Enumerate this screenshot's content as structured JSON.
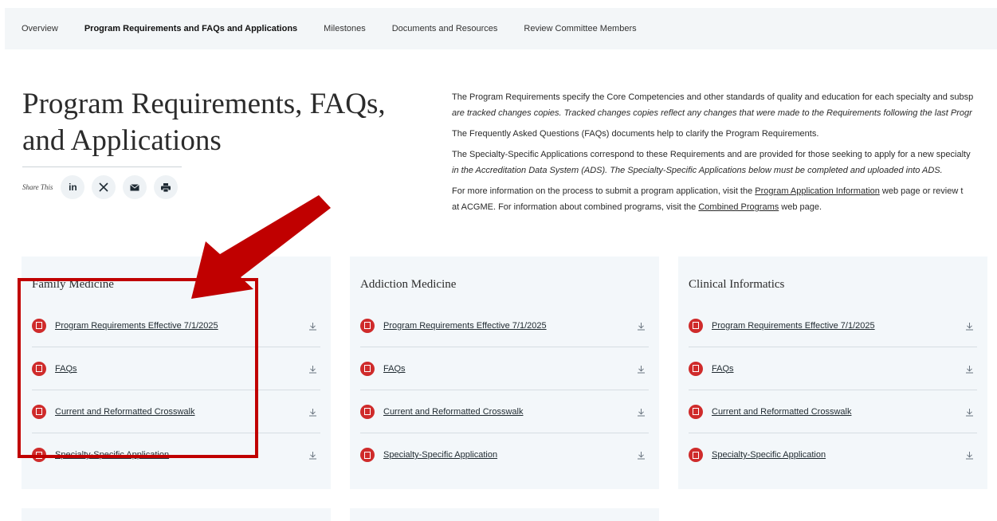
{
  "nav": {
    "items": [
      {
        "label": "Overview",
        "active": false
      },
      {
        "label": "Program Requirements and FAQs and Applications",
        "active": true
      },
      {
        "label": "Milestones",
        "active": false
      },
      {
        "label": "Documents and Resources",
        "active": false
      },
      {
        "label": "Review Committee Members",
        "active": false
      }
    ]
  },
  "page": {
    "title_line1": "Program Requirements, FAQs,",
    "title_line2": "and Applications"
  },
  "share": {
    "label": "Share This",
    "icons": [
      "linkedin-icon",
      "x-icon",
      "email-icon",
      "print-icon"
    ]
  },
  "intro": {
    "p1_line1": "The Program Requirements specify the Core Competencies and other standards of quality and education for each specialty and subsp",
    "p1_line2": "are tracked changes copies. Tracked changes copies reflect any changes that were made to the Requirements following the last Progr",
    "p2": "The Frequently Asked Questions (FAQs) documents help to clarify the Program Requirements.",
    "p3_line1": "The Specialty-Specific Applications correspond to these Requirements and are provided for those seeking to apply for a new specialty",
    "p3_line2": "in the Accreditation Data System (ADS). The Specialty-Specific Applications below must be completed and uploaded into ADS.",
    "p4_prefix": "For more information on the process to submit a program application, visit the ",
    "p4_link1": "Program Application Information",
    "p4_suffix": " web page or review t",
    "p4_line2_prefix": "at ACGME. For information about combined programs, visit the ",
    "p4_link2": "Combined Programs",
    "p4_line2_suffix": " web page."
  },
  "cards": [
    {
      "title": "Family Medicine",
      "docs": [
        "Program Requirements Effective 7/1/2025",
        "FAQs",
        "Current and Reformatted Crosswalk",
        "Specialty-Specific Application"
      ]
    },
    {
      "title": "Addiction Medicine",
      "docs": [
        "Program Requirements Effective 7/1/2025",
        "FAQs",
        "Current and Reformatted Crosswalk",
        "Specialty-Specific Application"
      ]
    },
    {
      "title": "Clinical Informatics",
      "docs": [
        "Program Requirements Effective 7/1/2025",
        "FAQs",
        "Current and Reformatted Crosswalk",
        "Specialty-Specific Application"
      ]
    }
  ],
  "colors": {
    "annotation": "#c00000",
    "pdf_icon": "#cf2b2b",
    "card_bg": "#f3f7fa"
  }
}
